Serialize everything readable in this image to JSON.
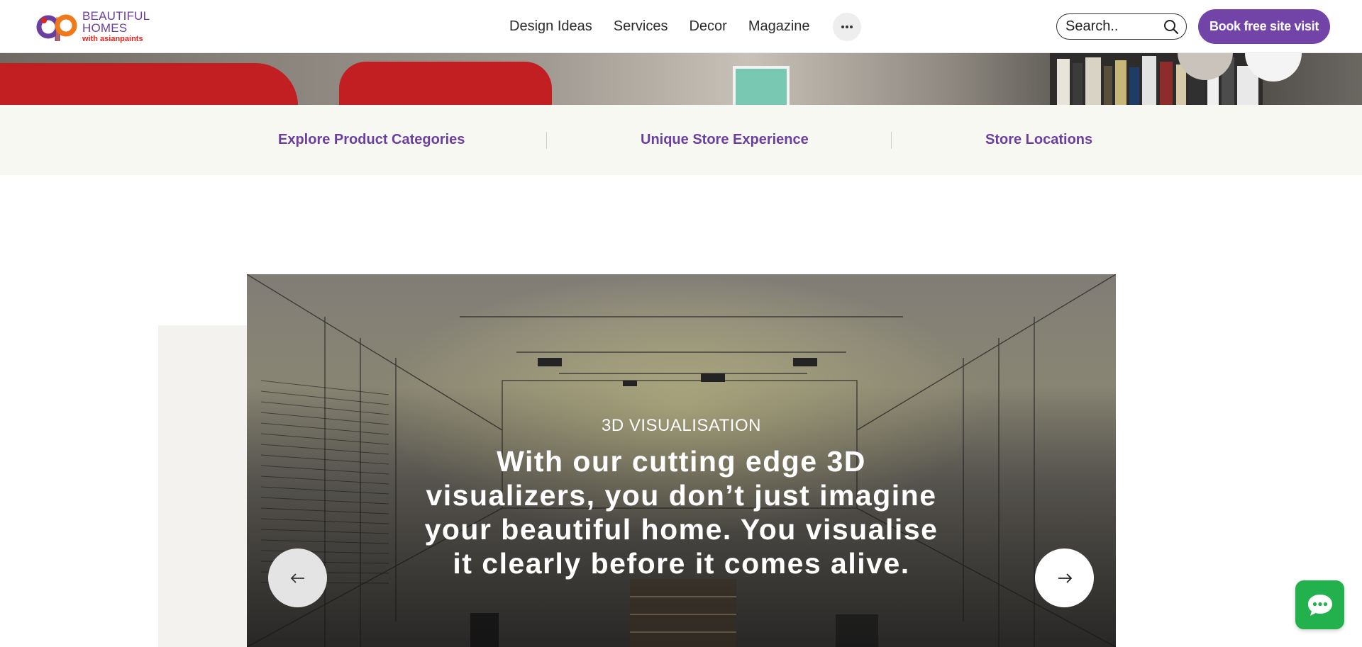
{
  "header": {
    "logo": {
      "line1": "BEAUTIFUL",
      "line2": "HOMES",
      "line3": "with asianpaints"
    },
    "nav": [
      {
        "label": "Design Ideas"
      },
      {
        "label": "Services"
      },
      {
        "label": "Decor"
      },
      {
        "label": "Magazine"
      }
    ],
    "more_label": "···",
    "search": {
      "placeholder": "Search.."
    },
    "book_label": "Book free site visit"
  },
  "subnav": [
    {
      "label": "Explore Product Categories"
    },
    {
      "label": "Unique Store Experience"
    },
    {
      "label": "Store Locations"
    }
  ],
  "slider": {
    "eyebrow": "3D VISUALISATION",
    "heading": "With our cutting edge 3D visualizers, you don’t just imagine your beautiful home. You visualise it clearly before it comes alive."
  },
  "icons": {
    "more": "ellipsis-icon",
    "search": "search-icon",
    "prev": "arrow-left-icon",
    "next": "arrow-right-icon",
    "chat": "chat-bubble-icon"
  },
  "colors": {
    "brand_purple": "#7244a8",
    "subnav_text": "#6b3fa0",
    "chat_green": "#22b14c",
    "subnav_bg": "#f8f8f3"
  }
}
